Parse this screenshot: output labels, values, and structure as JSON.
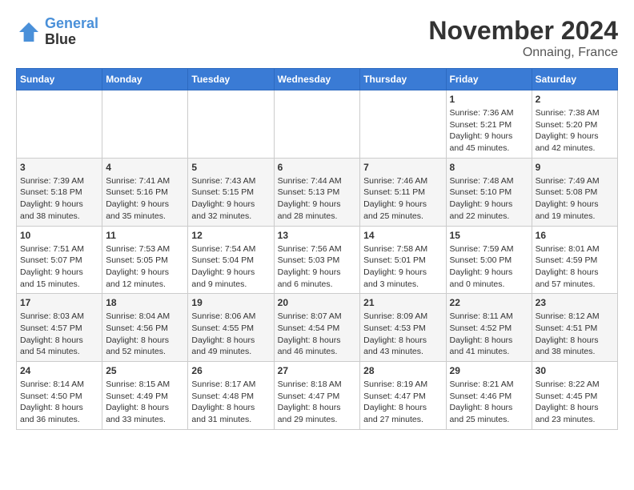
{
  "header": {
    "logo_line1": "General",
    "logo_line2": "Blue",
    "month": "November 2024",
    "location": "Onnaing, France"
  },
  "weekdays": [
    "Sunday",
    "Monday",
    "Tuesday",
    "Wednesday",
    "Thursday",
    "Friday",
    "Saturday"
  ],
  "weeks": [
    [
      {
        "day": "",
        "info": ""
      },
      {
        "day": "",
        "info": ""
      },
      {
        "day": "",
        "info": ""
      },
      {
        "day": "",
        "info": ""
      },
      {
        "day": "",
        "info": ""
      },
      {
        "day": "1",
        "info": "Sunrise: 7:36 AM\nSunset: 5:21 PM\nDaylight: 9 hours and 45 minutes."
      },
      {
        "day": "2",
        "info": "Sunrise: 7:38 AM\nSunset: 5:20 PM\nDaylight: 9 hours and 42 minutes."
      }
    ],
    [
      {
        "day": "3",
        "info": "Sunrise: 7:39 AM\nSunset: 5:18 PM\nDaylight: 9 hours and 38 minutes."
      },
      {
        "day": "4",
        "info": "Sunrise: 7:41 AM\nSunset: 5:16 PM\nDaylight: 9 hours and 35 minutes."
      },
      {
        "day": "5",
        "info": "Sunrise: 7:43 AM\nSunset: 5:15 PM\nDaylight: 9 hours and 32 minutes."
      },
      {
        "day": "6",
        "info": "Sunrise: 7:44 AM\nSunset: 5:13 PM\nDaylight: 9 hours and 28 minutes."
      },
      {
        "day": "7",
        "info": "Sunrise: 7:46 AM\nSunset: 5:11 PM\nDaylight: 9 hours and 25 minutes."
      },
      {
        "day": "8",
        "info": "Sunrise: 7:48 AM\nSunset: 5:10 PM\nDaylight: 9 hours and 22 minutes."
      },
      {
        "day": "9",
        "info": "Sunrise: 7:49 AM\nSunset: 5:08 PM\nDaylight: 9 hours and 19 minutes."
      }
    ],
    [
      {
        "day": "10",
        "info": "Sunrise: 7:51 AM\nSunset: 5:07 PM\nDaylight: 9 hours and 15 minutes."
      },
      {
        "day": "11",
        "info": "Sunrise: 7:53 AM\nSunset: 5:05 PM\nDaylight: 9 hours and 12 minutes."
      },
      {
        "day": "12",
        "info": "Sunrise: 7:54 AM\nSunset: 5:04 PM\nDaylight: 9 hours and 9 minutes."
      },
      {
        "day": "13",
        "info": "Sunrise: 7:56 AM\nSunset: 5:03 PM\nDaylight: 9 hours and 6 minutes."
      },
      {
        "day": "14",
        "info": "Sunrise: 7:58 AM\nSunset: 5:01 PM\nDaylight: 9 hours and 3 minutes."
      },
      {
        "day": "15",
        "info": "Sunrise: 7:59 AM\nSunset: 5:00 PM\nDaylight: 9 hours and 0 minutes."
      },
      {
        "day": "16",
        "info": "Sunrise: 8:01 AM\nSunset: 4:59 PM\nDaylight: 8 hours and 57 minutes."
      }
    ],
    [
      {
        "day": "17",
        "info": "Sunrise: 8:03 AM\nSunset: 4:57 PM\nDaylight: 8 hours and 54 minutes."
      },
      {
        "day": "18",
        "info": "Sunrise: 8:04 AM\nSunset: 4:56 PM\nDaylight: 8 hours and 52 minutes."
      },
      {
        "day": "19",
        "info": "Sunrise: 8:06 AM\nSunset: 4:55 PM\nDaylight: 8 hours and 49 minutes."
      },
      {
        "day": "20",
        "info": "Sunrise: 8:07 AM\nSunset: 4:54 PM\nDaylight: 8 hours and 46 minutes."
      },
      {
        "day": "21",
        "info": "Sunrise: 8:09 AM\nSunset: 4:53 PM\nDaylight: 8 hours and 43 minutes."
      },
      {
        "day": "22",
        "info": "Sunrise: 8:11 AM\nSunset: 4:52 PM\nDaylight: 8 hours and 41 minutes."
      },
      {
        "day": "23",
        "info": "Sunrise: 8:12 AM\nSunset: 4:51 PM\nDaylight: 8 hours and 38 minutes."
      }
    ],
    [
      {
        "day": "24",
        "info": "Sunrise: 8:14 AM\nSunset: 4:50 PM\nDaylight: 8 hours and 36 minutes."
      },
      {
        "day": "25",
        "info": "Sunrise: 8:15 AM\nSunset: 4:49 PM\nDaylight: 8 hours and 33 minutes."
      },
      {
        "day": "26",
        "info": "Sunrise: 8:17 AM\nSunset: 4:48 PM\nDaylight: 8 hours and 31 minutes."
      },
      {
        "day": "27",
        "info": "Sunrise: 8:18 AM\nSunset: 4:47 PM\nDaylight: 8 hours and 29 minutes."
      },
      {
        "day": "28",
        "info": "Sunrise: 8:19 AM\nSunset: 4:47 PM\nDaylight: 8 hours and 27 minutes."
      },
      {
        "day": "29",
        "info": "Sunrise: 8:21 AM\nSunset: 4:46 PM\nDaylight: 8 hours and 25 minutes."
      },
      {
        "day": "30",
        "info": "Sunrise: 8:22 AM\nSunset: 4:45 PM\nDaylight: 8 hours and 23 minutes."
      }
    ]
  ]
}
